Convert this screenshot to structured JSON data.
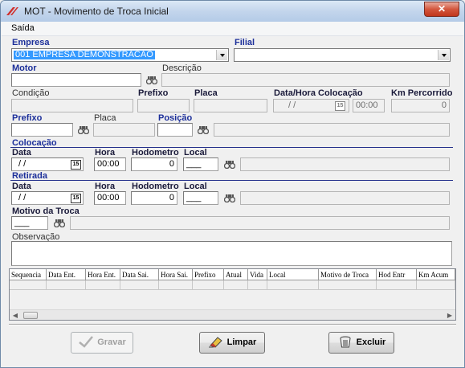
{
  "window": {
    "title": "MOT - Movimento de Troca Inicial",
    "close_glyph": "✕"
  },
  "menu": {
    "items": [
      "Saída"
    ]
  },
  "empresa": {
    "label": "Empresa",
    "value": "001 EMPRESA DEMONSTRACAO"
  },
  "filial": {
    "label": "Filial",
    "value": ""
  },
  "motor": {
    "label": "Motor",
    "value": "",
    "descricao_label": "Descrição",
    "descricao_value": ""
  },
  "info": {
    "condicao_label": "Condição",
    "condicao_value": "",
    "prefixo_label": "Prefixo",
    "prefixo_value": "",
    "placa_label": "Placa",
    "placa_value": "",
    "data_hora_label": "Data/Hora Colocação",
    "data_value": " / /",
    "hora_value": "00:00",
    "km_label": "Km Percorrido",
    "km_value": "0"
  },
  "veiculo": {
    "prefixo_label": "Prefixo",
    "prefixo_value": "",
    "placa_label": "Placa",
    "placa_value": "",
    "posicao_label": "Posição",
    "posicao_value": "",
    "posicao_desc": ""
  },
  "colocacao": {
    "section_label": "Colocação",
    "data_label": "Data",
    "data_value": " / /",
    "hora_label": "Hora",
    "hora_value": "00:00",
    "hodometro_label": "Hodometro",
    "hodometro_value": "0",
    "local_label": "Local",
    "local_value": "___",
    "local_desc": ""
  },
  "retirada": {
    "section_label": "Retirada",
    "data_label": "Data",
    "data_value": " / /",
    "hora_label": "Hora",
    "hora_value": "00:00",
    "hodometro_label": "Hodometro",
    "hodometro_value": "0",
    "local_label": "Local",
    "local_value": "___",
    "local_desc": ""
  },
  "motivo": {
    "label": "Motivo da Troca",
    "value": "___",
    "desc": ""
  },
  "observacao": {
    "label": "Observação",
    "value": ""
  },
  "grid": {
    "columns": [
      "Sequencia",
      "Data Ent.",
      "Hora Ent.",
      "Data Sai.",
      "Hora Sai.",
      "Prefixo",
      "Atual",
      "Vida",
      "Local",
      "Motivo de Troca",
      "Hod Entr",
      "Km Acum"
    ]
  },
  "buttons": {
    "gravar": "Gravar",
    "limpar": "Limpar",
    "excluir": "Excluir"
  },
  "icons": {
    "app": "app-logo-icon",
    "calendar_text": "15"
  }
}
